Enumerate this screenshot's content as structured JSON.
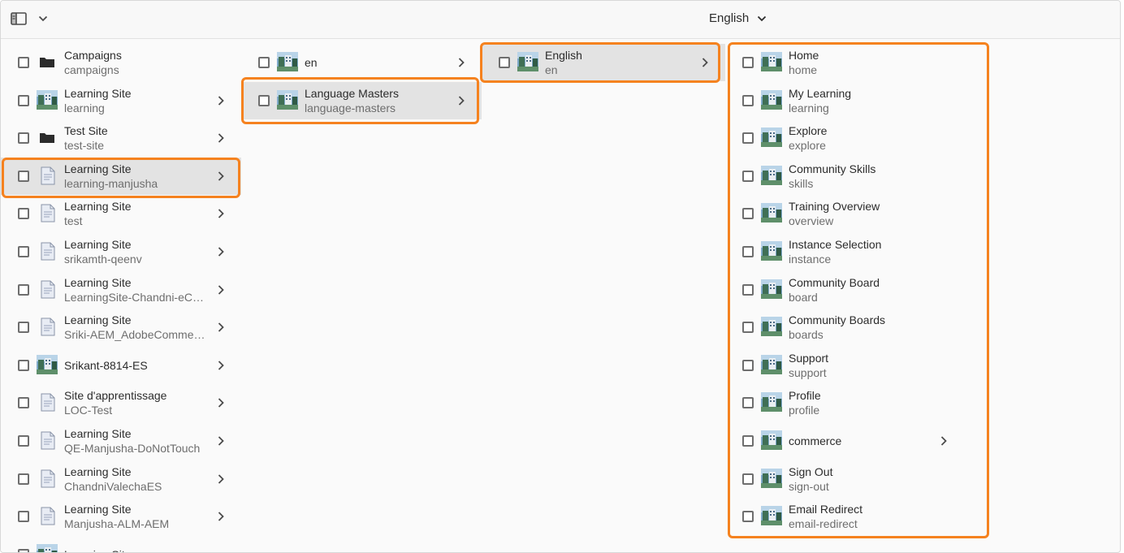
{
  "header": {
    "language": "English"
  },
  "columns": [
    {
      "items": [
        {
          "title": "Campaigns",
          "name": "campaigns",
          "icon": "folder-icon",
          "chevron": false
        },
        {
          "title": "Learning Site",
          "name": "learning",
          "icon": "site-thumbnail-icon",
          "chevron": true
        },
        {
          "title": "Test Site",
          "name": "test-site",
          "icon": "folder-icon",
          "chevron": true
        },
        {
          "title": "Learning Site",
          "name": "learning-manjusha",
          "icon": "page-icon",
          "chevron": true,
          "selected": true
        },
        {
          "title": "Learning Site",
          "name": "test",
          "icon": "page-icon",
          "chevron": true
        },
        {
          "title": "Learning Site",
          "name": "srikamth-qeenv",
          "icon": "page-icon",
          "chevron": true
        },
        {
          "title": "Learning Site",
          "name": "LearningSite-Chandni-eCom...",
          "icon": "page-icon",
          "chevron": true
        },
        {
          "title": "Learning Site",
          "name": "Sriki-AEM_AdobeCommerce",
          "icon": "page-icon",
          "chevron": true
        },
        {
          "title": "Srikant-8814-ES",
          "name": "",
          "icon": "site-thumbnail-icon",
          "chevron": true
        },
        {
          "title": "Site d'apprentissage",
          "name": "LOC-Test",
          "icon": "page-icon",
          "chevron": true
        },
        {
          "title": "Learning Site",
          "name": "QE-Manjusha-DoNotTouch",
          "icon": "page-icon",
          "chevron": true
        },
        {
          "title": "Learning Site",
          "name": "ChandniValechaES",
          "icon": "page-icon",
          "chevron": true
        },
        {
          "title": "Learning Site",
          "name": "Manjusha-ALM-AEM",
          "icon": "page-icon",
          "chevron": true
        },
        {
          "title": "Learning Site",
          "name": "",
          "icon": "site-thumbnail-icon",
          "chevron": false
        }
      ]
    },
    {
      "items": [
        {
          "title": "en",
          "name": "",
          "icon": "site-thumbnail-icon",
          "chevron": true
        },
        {
          "title": "Language Masters",
          "name": "language-masters",
          "icon": "site-thumbnail-icon",
          "chevron": true,
          "selected": true
        }
      ]
    },
    {
      "items": [
        {
          "title": "English",
          "name": "en",
          "icon": "site-thumbnail-icon",
          "chevron": true,
          "selected": true
        }
      ]
    },
    {
      "items": [
        {
          "title": "Home",
          "name": "home",
          "icon": "site-thumbnail-icon",
          "chevron": false
        },
        {
          "title": "My Learning",
          "name": "learning",
          "icon": "site-thumbnail-icon",
          "chevron": false
        },
        {
          "title": "Explore",
          "name": "explore",
          "icon": "site-thumbnail-icon",
          "chevron": false
        },
        {
          "title": "Community Skills",
          "name": "skills",
          "icon": "site-thumbnail-icon",
          "chevron": false
        },
        {
          "title": "Training Overview",
          "name": "overview",
          "icon": "site-thumbnail-icon",
          "chevron": false
        },
        {
          "title": "Instance Selection",
          "name": "instance",
          "icon": "site-thumbnail-icon",
          "chevron": false
        },
        {
          "title": "Community Board",
          "name": "board",
          "icon": "site-thumbnail-icon",
          "chevron": false
        },
        {
          "title": "Community Boards",
          "name": "boards",
          "icon": "site-thumbnail-icon",
          "chevron": false
        },
        {
          "title": "Support",
          "name": "support",
          "icon": "site-thumbnail-icon",
          "chevron": false
        },
        {
          "title": "Profile",
          "name": "profile",
          "icon": "site-thumbnail-icon",
          "chevron": false
        },
        {
          "title": "commerce",
          "name": "",
          "icon": "site-thumbnail-icon",
          "chevron": true
        },
        {
          "title": "Sign Out",
          "name": "sign-out",
          "icon": "site-thumbnail-icon",
          "chevron": false
        },
        {
          "title": "Email Redirect",
          "name": "email-redirect",
          "icon": "site-thumbnail-icon",
          "chevron": false
        }
      ]
    }
  ],
  "colors": {
    "highlight": "#f5821f",
    "selected_row": "#e3e3e3"
  }
}
